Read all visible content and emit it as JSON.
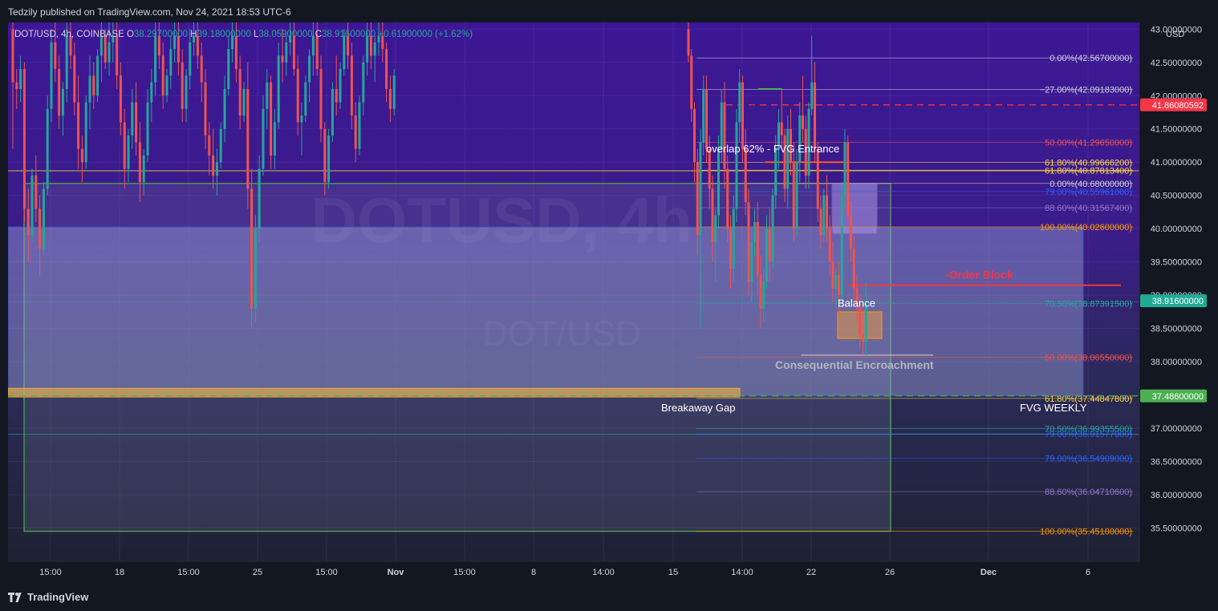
{
  "header": {
    "published": "Tedzily published on TradingView.com, Nov 24, 2021 18:53 UTC-6"
  },
  "footer": {
    "brand": "TradingView"
  },
  "colors": {
    "bg_main": "#3a1a86",
    "bg_lower": "#222a3d",
    "up": "#26a69a",
    "down": "#ef5350",
    "fvg_box": "#7d86c6",
    "green_box": "#4caf50",
    "price_tag_red": "#f23645",
    "price_tag_green": "#4caf50",
    "price_tag_teal": "#22ab94"
  },
  "chart_data": {
    "type": "candlestick",
    "symbol_line": {
      "symbol": "DOT/USD, 4h, COINBASE",
      "open": "O38.29700000",
      "high": "H39.18000000",
      "low": "L38.05900000",
      "close": "C38.91600000",
      "change": "+0.61900000 (+1.62%)"
    },
    "watermark": {
      "main": "DOTUSD, 4h",
      "sub": "DOT/USD"
    },
    "currency": "USD",
    "y_axis": {
      "min": 35.0,
      "max": 43.1,
      "ticks": [
        "43.00000000",
        "42.50000000",
        "42.00000000",
        "41.50000000",
        "41.00000000",
        "40.50000000",
        "40.00000000",
        "39.50000000",
        "39.00000000",
        "38.50000000",
        "38.00000000",
        "37.50000000",
        "37.00000000",
        "36.50000000",
        "36.00000000",
        "35.50000000"
      ],
      "tick_values": [
        43,
        42.5,
        42,
        41.5,
        41,
        40.5,
        40,
        39.5,
        39,
        38.5,
        38,
        37.5,
        37,
        36.5,
        36,
        35.5
      ]
    },
    "x_axis": {
      "labels": [
        "15:00",
        "18",
        "15:00",
        "25",
        "15:00",
        "Nov",
        "15:00",
        "8",
        "14:00",
        "15",
        "14:00",
        "22",
        "26",
        "Dec",
        "6"
      ],
      "bold": [
        false,
        false,
        false,
        false,
        false,
        true,
        false,
        false,
        false,
        false,
        false,
        false,
        false,
        true,
        false
      ]
    },
    "price_tags": [
      {
        "value": 41.8608,
        "label": "41.86080592",
        "color": "#f23645"
      },
      {
        "value": 38.916,
        "label": "38.91600000",
        "color": "#22ab94"
      },
      {
        "value": 37.486,
        "label": "37.48600000",
        "color": "#4caf50"
      }
    ],
    "fib_levels": [
      {
        "value": 42.567,
        "label": "0.00%(42.56700000)",
        "color": "#d1d4dc"
      },
      {
        "value": 42.09183,
        "label": "−27.00%(42.09183000)",
        "color": "#d1d4dc"
      },
      {
        "value": 41.2965,
        "label": "50.00%(41.29650000)",
        "color": "#ef5350"
      },
      {
        "value": 40.99666,
        "label": "61.80%(40.99666200)",
        "color": "#ffd54f"
      },
      {
        "value": 40.87813,
        "label": "61.80%(40.87813400)",
        "color": "#ffd54f"
      },
      {
        "value": 40.68,
        "label": "0.00%(40.68000000)",
        "color": "#d1d4dc"
      },
      {
        "value": 40.55961,
        "label": "79.00%(40.55961000)",
        "color": "#2962ff"
      },
      {
        "value": 40.31567,
        "label": "88.60%(40.31567400)",
        "color": "#9575cd"
      },
      {
        "value": 40.026,
        "label": "100.00%(40.02600000)",
        "color": "#ff9800"
      },
      {
        "value": 38.87392,
        "label": "70.50%(38.87391500)",
        "color": "#26a69a"
      },
      {
        "value": 38.0655,
        "label": "50.00%(38.06550000)",
        "color": "#ef5350"
      },
      {
        "value": 37.44848,
        "label": "61.80%(37.44847800)",
        "color": "#ffd54f"
      },
      {
        "value": 36.99356,
        "label": "70.50%(36.99355500)",
        "color": "#26a69a"
      },
      {
        "value": 36.91577,
        "label": "79.00%(36.91577000)",
        "color": "#2962ff"
      },
      {
        "value": 36.54909,
        "label": "79.00%(36.54909000)",
        "color": "#2962ff"
      },
      {
        "value": 36.04711,
        "label": "88.60%(36.04710600)",
        "color": "#9575cd"
      },
      {
        "value": 35.451,
        "label": "100.00%(35.45100000)",
        "color": "#ff9800"
      }
    ],
    "annotations": {
      "order_block": "-Order Block",
      "balance": "Balance",
      "consequential": "Consequential Encroachment",
      "breakaway": "Breakaway Gap",
      "fvg_weekly": "FVG WEEKLY",
      "overlap": "overlap 62% - FVG Entrance"
    },
    "zones": {
      "fvg_weekly_top": 40.026,
      "fvg_weekly_bottom": 37.486,
      "green_top": 40.68,
      "green_bottom": 35.451,
      "breakaway_top": 37.6,
      "breakaway_bottom": 37.47,
      "balance_top": 38.75,
      "balance_bottom": 38.35,
      "fvg_entrance_top": 40.68,
      "fvg_entrance_bottom": 39.92,
      "order_block": 39.15,
      "overlap_level": 41.0,
      "consequential_level": 38.07
    },
    "candles": [
      [
        43.0,
        43.1,
        41.2,
        42.2
      ],
      [
        42.2,
        42.4,
        41.8,
        42.1
      ],
      [
        42.1,
        42.6,
        41.9,
        42.4
      ],
      [
        42.4,
        42.5,
        40.1,
        40.3
      ],
      [
        40.3,
        40.6,
        39.5,
        39.9
      ],
      [
        39.9,
        40.9,
        39.8,
        40.8
      ],
      [
        40.8,
        41.1,
        40.1,
        40.3
      ],
      [
        40.3,
        40.5,
        39.3,
        39.7
      ],
      [
        39.7,
        40.7,
        39.6,
        40.6
      ],
      [
        40.6,
        42.0,
        40.5,
        41.8
      ],
      [
        41.8,
        43.0,
        41.6,
        42.8
      ],
      [
        42.8,
        43.1,
        42.2,
        42.4
      ],
      [
        42.4,
        42.6,
        41.5,
        41.7
      ],
      [
        41.7,
        42.2,
        41.4,
        42.1
      ],
      [
        42.1,
        43.1,
        41.9,
        42.9
      ],
      [
        42.9,
        43.1,
        42.4,
        42.6
      ],
      [
        42.6,
        42.8,
        41.7,
        41.9
      ],
      [
        41.9,
        42.3,
        40.9,
        41.2
      ],
      [
        41.2,
        41.4,
        40.7,
        41.0
      ],
      [
        41.0,
        42.0,
        40.9,
        41.9
      ],
      [
        41.9,
        42.6,
        41.5,
        42.3
      ],
      [
        42.3,
        42.5,
        41.8,
        42.0
      ],
      [
        42.0,
        42.7,
        41.9,
        42.6
      ],
      [
        42.6,
        43.1,
        42.2,
        42.9
      ],
      [
        42.9,
        43.0,
        42.4,
        42.5
      ],
      [
        42.5,
        43.1,
        42.3,
        42.8
      ],
      [
        42.8,
        43.1,
        42.5,
        42.9
      ],
      [
        42.9,
        43.1,
        42.1,
        42.3
      ],
      [
        42.3,
        42.5,
        41.4,
        41.6
      ],
      [
        41.6,
        41.8,
        40.6,
        40.9
      ],
      [
        40.9,
        41.5,
        40.7,
        41.4
      ],
      [
        41.4,
        42.1,
        41.2,
        41.9
      ],
      [
        41.9,
        42.2,
        41.1,
        41.3
      ],
      [
        41.3,
        41.6,
        40.4,
        40.7
      ],
      [
        40.7,
        41.2,
        40.5,
        41.1
      ],
      [
        41.1,
        42.1,
        41.0,
        41.9
      ],
      [
        41.9,
        42.4,
        41.6,
        42.2
      ],
      [
        42.2,
        43.1,
        42.0,
        42.9
      ],
      [
        42.9,
        43.1,
        42.4,
        42.6
      ],
      [
        42.6,
        42.8,
        41.8,
        42.0
      ],
      [
        42.0,
        42.4,
        41.9,
        42.3
      ],
      [
        42.3,
        42.9,
        42.1,
        42.7
      ],
      [
        42.7,
        43.1,
        42.5,
        42.9
      ],
      [
        42.9,
        43.1,
        42.3,
        42.5
      ],
      [
        42.5,
        42.7,
        41.6,
        41.8
      ],
      [
        41.8,
        42.4,
        41.6,
        42.3
      ],
      [
        42.3,
        43.0,
        42.1,
        42.8
      ],
      [
        42.8,
        43.1,
        42.6,
        42.9
      ],
      [
        42.9,
        43.1,
        42.4,
        42.6
      ],
      [
        42.6,
        42.8,
        41.9,
        42.2
      ],
      [
        42.2,
        42.4,
        41.2,
        41.4
      ],
      [
        41.4,
        41.6,
        40.8,
        41.1
      ],
      [
        41.1,
        41.5,
        40.6,
        40.8
      ],
      [
        40.8,
        41.2,
        40.5,
        41.0
      ],
      [
        41.0,
        41.6,
        40.9,
        41.5
      ],
      [
        41.5,
        42.3,
        41.3,
        42.1
      ],
      [
        42.1,
        42.9,
        42.0,
        42.7
      ],
      [
        42.7,
        43.1,
        42.5,
        42.9
      ],
      [
        42.9,
        43.1,
        42.2,
        42.4
      ],
      [
        42.4,
        42.6,
        41.5,
        41.7
      ],
      [
        41.7,
        42.2,
        41.6,
        42.1
      ],
      [
        42.1,
        42.5,
        40.3,
        40.6
      ],
      [
        40.6,
        40.9,
        38.5,
        38.8
      ],
      [
        38.8,
        40.2,
        38.6,
        40.0
      ],
      [
        40.0,
        41.1,
        39.8,
        40.9
      ],
      [
        40.9,
        42.0,
        40.8,
        41.8
      ],
      [
        41.8,
        42.4,
        41.5,
        42.2
      ],
      [
        42.2,
        42.3,
        40.9,
        41.1
      ],
      [
        41.1,
        41.8,
        40.9,
        41.6
      ],
      [
        41.6,
        42.8,
        41.5,
        42.6
      ],
      [
        42.6,
        43.0,
        42.2,
        42.5
      ],
      [
        42.5,
        42.9,
        42.3,
        42.8
      ],
      [
        42.8,
        43.1,
        42.6,
        42.9
      ],
      [
        42.9,
        43.1,
        42.3,
        42.4
      ],
      [
        42.4,
        42.6,
        41.4,
        41.6
      ],
      [
        41.6,
        41.9,
        41.1,
        41.7
      ],
      [
        41.7,
        42.3,
        41.6,
        42.2
      ],
      [
        42.2,
        42.7,
        41.9,
        42.6
      ],
      [
        42.6,
        43.1,
        42.3,
        42.9
      ],
      [
        42.9,
        43.1,
        42.3,
        42.4
      ],
      [
        42.4,
        42.6,
        41.3,
        41.5
      ],
      [
        41.5,
        41.6,
        40.5,
        40.7
      ],
      [
        40.7,
        41.5,
        40.6,
        41.4
      ],
      [
        41.4,
        42.2,
        41.3,
        42.1
      ],
      [
        42.1,
        42.6,
        41.7,
        41.9
      ],
      [
        41.9,
        42.5,
        41.8,
        42.4
      ],
      [
        42.4,
        43.0,
        42.3,
        42.9
      ],
      [
        42.9,
        43.1,
        42.4,
        42.6
      ],
      [
        42.6,
        42.8,
        41.5,
        41.7
      ],
      [
        41.7,
        41.9,
        41.0,
        41.2
      ],
      [
        41.2,
        42.0,
        41.1,
        41.9
      ],
      [
        41.9,
        42.6,
        41.7,
        42.5
      ],
      [
        42.5,
        43.1,
        42.3,
        42.9
      ],
      [
        42.9,
        43.1,
        42.4,
        42.6
      ],
      [
        42.6,
        42.9,
        42.2,
        42.8
      ],
      [
        42.8,
        43.1,
        42.6,
        42.9
      ],
      [
        42.9,
        43.1,
        42.5,
        42.7
      ],
      [
        42.7,
        42.8,
        41.9,
        42.1
      ],
      [
        42.1,
        42.3,
        41.6,
        41.8
      ],
      [
        41.8,
        42.4,
        41.7,
        42.3
      ]
    ],
    "candles2": [
      [
        43.0,
        43.1,
        42.5,
        42.6
      ],
      [
        42.6,
        42.7,
        41.6,
        41.8
      ],
      [
        41.8,
        41.9,
        40.7,
        41.0
      ],
      [
        41.0,
        41.2,
        39.6,
        39.9
      ],
      [
        39.9,
        41.5,
        38.5,
        41.3
      ],
      [
        41.3,
        42.3,
        41.1,
        42.1
      ],
      [
        42.1,
        42.3,
        41.0,
        41.2
      ],
      [
        41.2,
        41.4,
        40.3,
        40.6
      ],
      [
        40.6,
        40.8,
        39.5,
        39.8
      ],
      [
        39.8,
        40.3,
        39.2,
        40.2
      ],
      [
        40.2,
        41.4,
        40.0,
        41.2
      ],
      [
        41.2,
        42.1,
        41.0,
        41.9
      ],
      [
        41.9,
        42.2,
        40.6,
        40.9
      ],
      [
        40.9,
        41.1,
        39.8,
        40.0
      ],
      [
        40.0,
        40.2,
        39.1,
        39.4
      ],
      [
        39.4,
        40.5,
        39.2,
        40.3
      ],
      [
        40.3,
        41.8,
        40.1,
        41.6
      ],
      [
        41.6,
        42.4,
        41.3,
        42.2
      ],
      [
        42.2,
        42.3,
        41.0,
        41.2
      ],
      [
        41.2,
        41.5,
        40.2,
        40.4
      ],
      [
        40.4,
        40.6,
        39.0,
        39.2
      ],
      [
        39.2,
        40.0,
        38.9,
        39.8
      ],
      [
        39.8,
        40.3,
        39.6,
        40.1
      ],
      [
        40.1,
        40.4,
        39.0,
        39.3
      ],
      [
        39.3,
        39.6,
        38.5,
        38.8
      ],
      [
        38.8,
        39.4,
        38.6,
        39.2
      ],
      [
        39.2,
        40.2,
        39.1,
        40.0
      ],
      [
        40.0,
        40.3,
        39.2,
        39.5
      ],
      [
        39.5,
        40.6,
        39.4,
        40.5
      ],
      [
        40.5,
        41.4,
        40.3,
        41.2
      ],
      [
        41.2,
        41.8,
        40.9,
        41.6
      ],
      [
        41.6,
        42.1,
        41.2,
        41.4
      ],
      [
        41.4,
        41.5,
        40.4,
        40.6
      ],
      [
        40.6,
        41.7,
        40.3,
        41.5
      ],
      [
        41.5,
        41.8,
        40.8,
        41.0
      ],
      [
        41.0,
        41.3,
        39.8,
        40.0
      ],
      [
        40.0,
        41.2,
        39.9,
        41.0
      ],
      [
        41.0,
        41.9,
        40.7,
        41.7
      ],
      [
        41.7,
        42.3,
        41.3,
        41.5
      ],
      [
        41.5,
        41.7,
        40.6,
        40.8
      ],
      [
        40.8,
        41.9,
        40.6,
        41.8
      ],
      [
        41.8,
        42.9,
        41.7,
        42.2
      ],
      [
        42.2,
        42.5,
        41.0,
        41.2
      ],
      [
        41.2,
        41.3,
        40.1,
        40.3
      ],
      [
        40.3,
        40.5,
        39.7,
        39.9
      ],
      [
        39.9,
        40.6,
        39.8,
        40.5
      ],
      [
        40.5,
        40.8,
        39.8,
        40.0
      ],
      [
        40.0,
        40.2,
        39.3,
        39.5
      ],
      [
        39.5,
        39.8,
        38.9,
        39.1
      ],
      [
        39.1,
        39.4,
        38.8,
        39.3
      ],
      [
        39.3,
        39.5,
        38.7,
        39.0
      ],
      [
        39.0,
        40.7,
        38.9,
        40.5
      ],
      [
        40.5,
        41.5,
        40.3,
        41.3
      ],
      [
        41.3,
        41.4,
        40.1,
        40.2
      ],
      [
        40.2,
        40.4,
        39.5,
        39.7
      ],
      [
        39.7,
        39.9,
        38.9,
        39.1
      ],
      [
        39.1,
        39.3,
        38.6,
        38.8
      ],
      [
        38.8,
        39.0,
        38.2,
        38.4
      ],
      [
        38.4,
        38.9,
        38.1,
        38.3
      ],
      [
        38.3,
        39.2,
        38.06,
        38.9
      ]
    ]
  }
}
